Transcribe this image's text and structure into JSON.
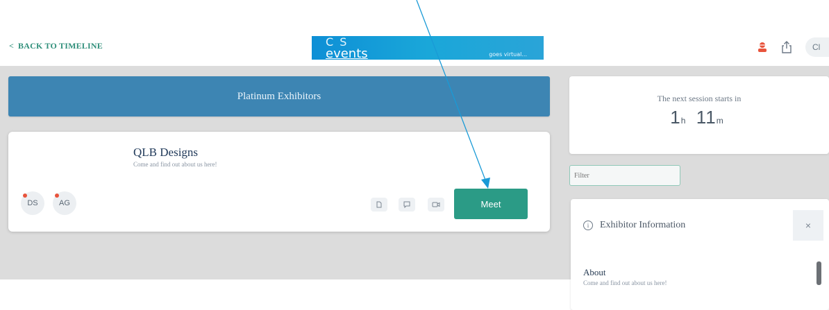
{
  "nav": {
    "back_label": "BACK TO TIMELINE"
  },
  "brand": {
    "logo_top": "C S",
    "logo_bottom": "events",
    "tagline": "goes virtual..."
  },
  "header_actions": {
    "profile_initials": "Cl"
  },
  "section": {
    "title": "Platinum Exhibitors"
  },
  "exhibitor": {
    "name": "QLB Designs",
    "tagline": "Come and find out about us here!",
    "reps": [
      "DS",
      "AG"
    ],
    "meet_label": "Meet"
  },
  "session": {
    "label": "The next session starts in",
    "hours": "1",
    "hours_unit": "h",
    "minutes": "11",
    "minutes_unit": "m"
  },
  "filter": {
    "placeholder": "Filter"
  },
  "info_panel": {
    "title": "Exhibitor Information",
    "close_label": "×",
    "about_title": "About",
    "about_text": "Come and find out about us here!"
  },
  "colors": {
    "accent": "#2b9b86",
    "header_blue": "#3d85b3",
    "arrow": "#1a9ad6"
  }
}
